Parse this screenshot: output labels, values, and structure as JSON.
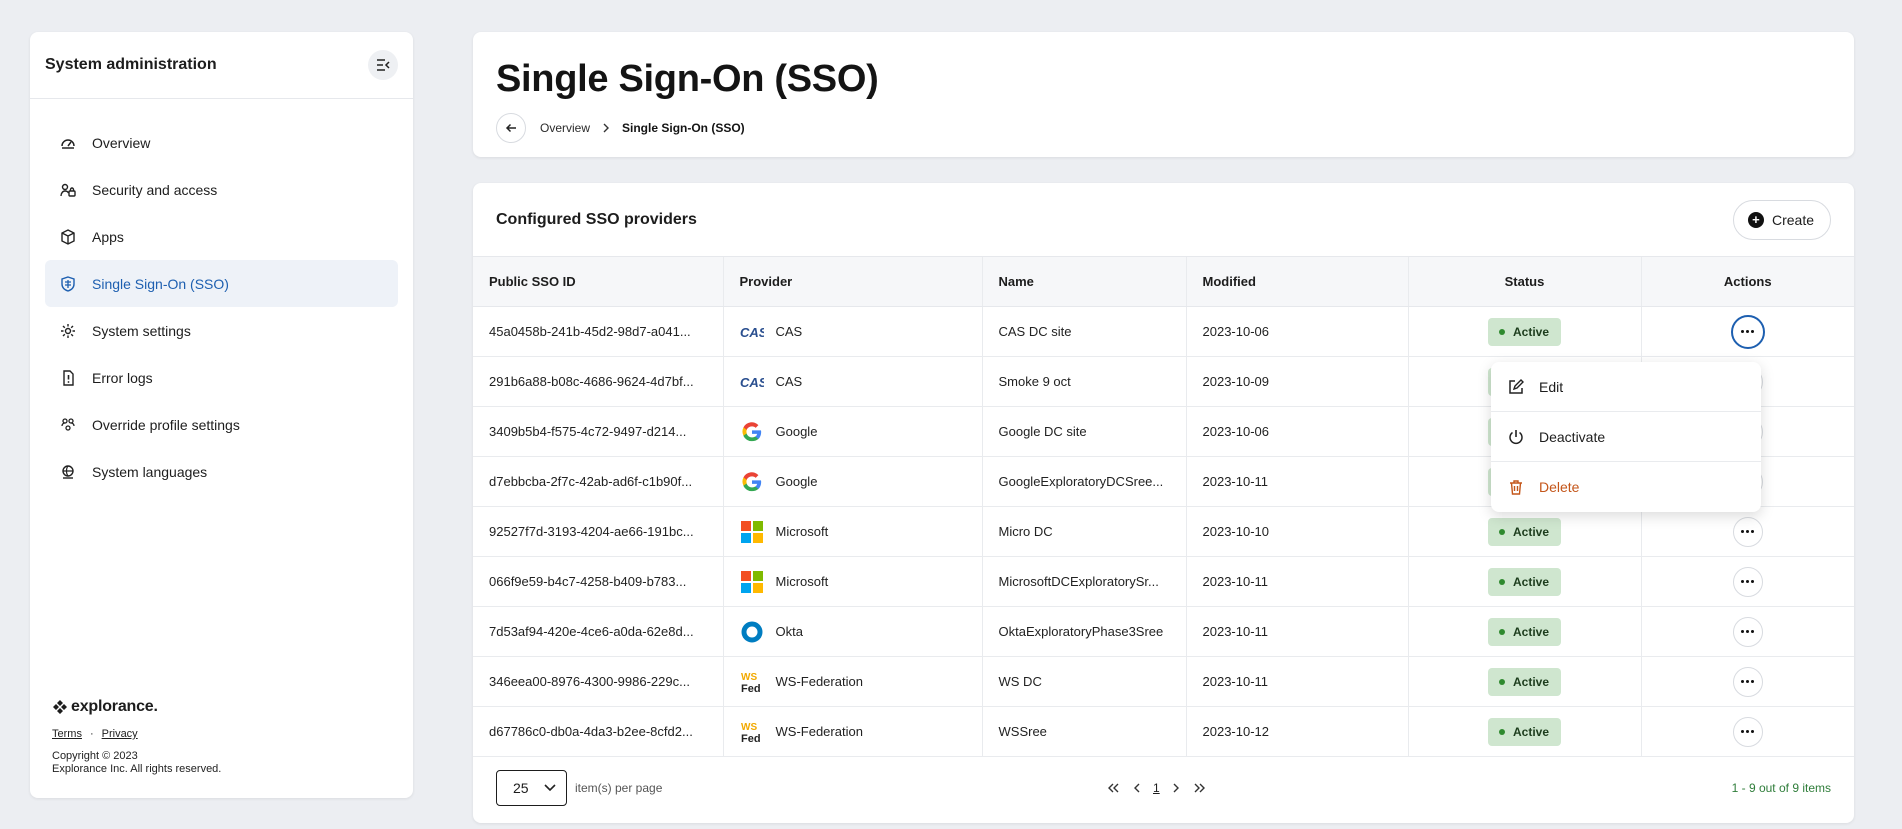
{
  "sidebar": {
    "title": "System administration",
    "items": [
      {
        "label": "Overview",
        "icon": "gauge-icon"
      },
      {
        "label": "Security and access",
        "icon": "security-icon"
      },
      {
        "label": "Apps",
        "icon": "apps-icon"
      },
      {
        "label": "Single Sign-On (SSO)",
        "icon": "shield-icon",
        "active": true
      },
      {
        "label": "System settings",
        "icon": "gear-icon"
      },
      {
        "label": "Error logs",
        "icon": "error-log-icon"
      },
      {
        "label": "Override profile settings",
        "icon": "profiles-icon"
      },
      {
        "label": "System languages",
        "icon": "globe-icon"
      }
    ],
    "brand": "explorance.",
    "terms_label": "Terms",
    "footer_sep": "·",
    "privacy_label": "Privacy",
    "copyright_line1": "Copyright © 2023",
    "copyright_line2": "Explorance Inc. All rights reserved."
  },
  "header": {
    "title": "Single Sign-On (SSO)",
    "breadcrumb": {
      "parent": "Overview",
      "current": "Single Sign-On (SSO)"
    }
  },
  "table_section": {
    "title": "Configured SSO providers",
    "create_label": "Create",
    "columns": [
      "Public SSO ID",
      "Provider",
      "Name",
      "Modified",
      "Status",
      "Actions"
    ],
    "rows": [
      {
        "id": "45a0458b-241b-45d2-98d7-a041...",
        "provider": "CAS",
        "logo": "cas",
        "name": "CAS DC site",
        "modified": "2023-10-06",
        "status": "Active"
      },
      {
        "id": "291b6a88-b08c-4686-9624-4d7bf...",
        "provider": "CAS",
        "logo": "cas",
        "name": "Smoke 9 oct",
        "modified": "2023-10-09",
        "status": "Active"
      },
      {
        "id": "3409b5b4-f575-4c72-9497-d214...",
        "provider": "Google",
        "logo": "google",
        "name": "Google DC site",
        "modified": "2023-10-06",
        "status": "Active"
      },
      {
        "id": "d7ebbcba-2f7c-42ab-ad6f-c1b90f...",
        "provider": "Google",
        "logo": "google",
        "name": "GoogleExploratoryDCSree...",
        "modified": "2023-10-11",
        "status": "Active"
      },
      {
        "id": "92527f7d-3193-4204-ae66-191bc...",
        "provider": "Microsoft",
        "logo": "microsoft",
        "name": "Micro DC",
        "modified": "2023-10-10",
        "status": "Active"
      },
      {
        "id": "066f9e59-b4c7-4258-b409-b783...",
        "provider": "Microsoft",
        "logo": "microsoft",
        "name": "MicrosoftDCExploratorySr...",
        "modified": "2023-10-11",
        "status": "Active"
      },
      {
        "id": "7d53af94-420e-4ce6-a0da-62e8d...",
        "provider": "Okta",
        "logo": "okta",
        "name": "OktaExploratoryPhase3Sree",
        "modified": "2023-10-11",
        "status": "Active"
      },
      {
        "id": "346eea00-8976-4300-9986-229c...",
        "provider": "WS-Federation",
        "logo": "wsfed",
        "name": "WS DC",
        "modified": "2023-10-11",
        "status": "Active"
      },
      {
        "id": "d67786c0-db0a-4da3-b2ee-8cfd2...",
        "provider": "WS-Federation",
        "logo": "wsfed",
        "name": "WSSree",
        "modified": "2023-10-12",
        "status": "Active"
      }
    ],
    "actions_menu": {
      "edit": "Edit",
      "deactivate": "Deactivate",
      "delete": "Delete"
    }
  },
  "pagination": {
    "per_page": "25",
    "per_page_label": "item(s) per page",
    "current_page": "1",
    "summary": "1 - 9 out of 9 items"
  },
  "colors": {
    "accent": "#1d5fb0",
    "active_badge": "#cfe6cf",
    "danger": "#c4561a",
    "summary_text": "#2f7d3a"
  }
}
